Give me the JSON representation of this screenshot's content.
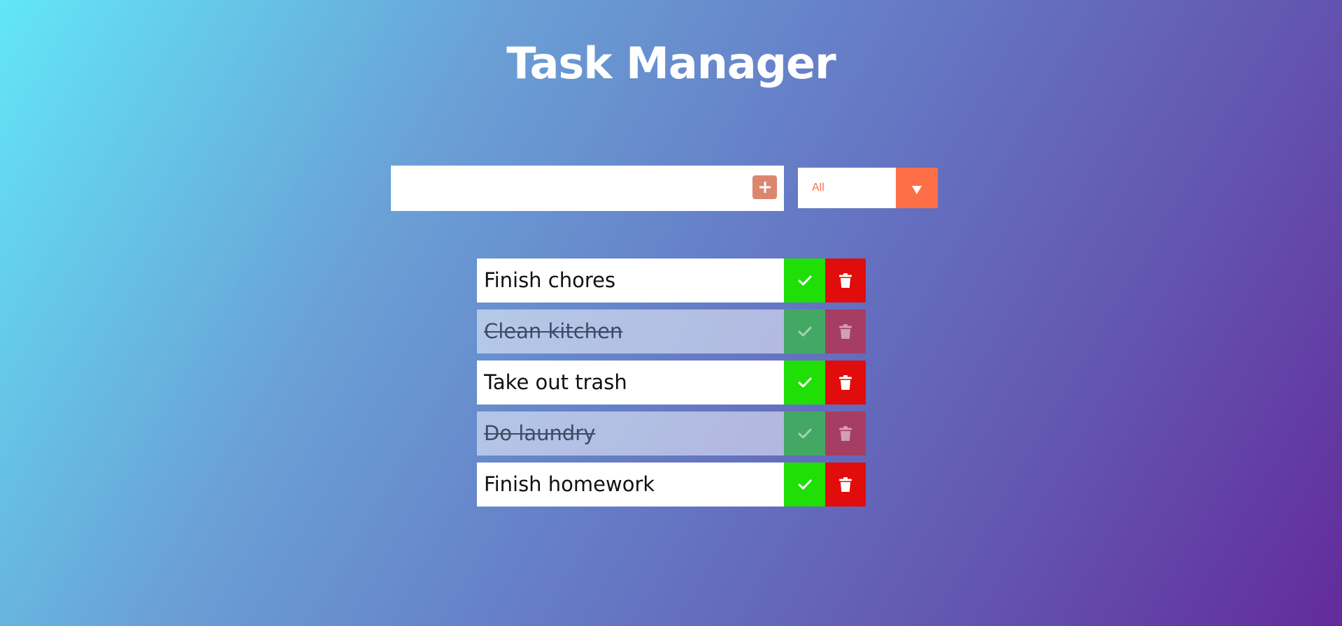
{
  "header": {
    "title": "Task Manager"
  },
  "input": {
    "value": "",
    "placeholder": ""
  },
  "add_button": {
    "icon": "plus-icon"
  },
  "filter": {
    "selected": "All",
    "icon": "caret-down-icon"
  },
  "todos": [
    {
      "text": "Finish chores",
      "completed": false
    },
    {
      "text": "Clean kitchen",
      "completed": true
    },
    {
      "text": "Take out trash",
      "completed": false
    },
    {
      "text": "Do laundry",
      "completed": true
    },
    {
      "text": "Finish homework",
      "completed": false
    }
  ],
  "icons": {
    "complete": "check-icon",
    "delete": "trash-icon"
  },
  "colors": {
    "accent": "#ff6f47",
    "add_button": "#dc8670",
    "check": "#1fdf07",
    "trash": "#e10c0c",
    "check_done": "#44a865",
    "trash_done": "#a63e64"
  }
}
